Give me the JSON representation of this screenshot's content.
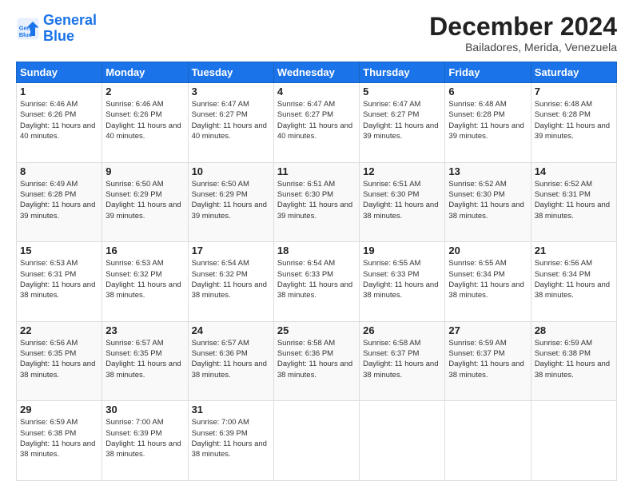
{
  "logo": {
    "line1": "General",
    "line2": "Blue"
  },
  "title": "December 2024",
  "location": "Bailadores, Merida, Venezuela",
  "days_header": [
    "Sunday",
    "Monday",
    "Tuesday",
    "Wednesday",
    "Thursday",
    "Friday",
    "Saturday"
  ],
  "weeks": [
    [
      {
        "day": "1",
        "sunrise": "6:46 AM",
        "sunset": "6:26 PM",
        "daylight": "11 hours and 40 minutes."
      },
      {
        "day": "2",
        "sunrise": "6:46 AM",
        "sunset": "6:26 PM",
        "daylight": "11 hours and 40 minutes."
      },
      {
        "day": "3",
        "sunrise": "6:47 AM",
        "sunset": "6:27 PM",
        "daylight": "11 hours and 40 minutes."
      },
      {
        "day": "4",
        "sunrise": "6:47 AM",
        "sunset": "6:27 PM",
        "daylight": "11 hours and 40 minutes."
      },
      {
        "day": "5",
        "sunrise": "6:47 AM",
        "sunset": "6:27 PM",
        "daylight": "11 hours and 39 minutes."
      },
      {
        "day": "6",
        "sunrise": "6:48 AM",
        "sunset": "6:28 PM",
        "daylight": "11 hours and 39 minutes."
      },
      {
        "day": "7",
        "sunrise": "6:48 AM",
        "sunset": "6:28 PM",
        "daylight": "11 hours and 39 minutes."
      }
    ],
    [
      {
        "day": "8",
        "sunrise": "6:49 AM",
        "sunset": "6:28 PM",
        "daylight": "11 hours and 39 minutes."
      },
      {
        "day": "9",
        "sunrise": "6:50 AM",
        "sunset": "6:29 PM",
        "daylight": "11 hours and 39 minutes."
      },
      {
        "day": "10",
        "sunrise": "6:50 AM",
        "sunset": "6:29 PM",
        "daylight": "11 hours and 39 minutes."
      },
      {
        "day": "11",
        "sunrise": "6:51 AM",
        "sunset": "6:30 PM",
        "daylight": "11 hours and 39 minutes."
      },
      {
        "day": "12",
        "sunrise": "6:51 AM",
        "sunset": "6:30 PM",
        "daylight": "11 hours and 38 minutes."
      },
      {
        "day": "13",
        "sunrise": "6:52 AM",
        "sunset": "6:30 PM",
        "daylight": "11 hours and 38 minutes."
      },
      {
        "day": "14",
        "sunrise": "6:52 AM",
        "sunset": "6:31 PM",
        "daylight": "11 hours and 38 minutes."
      }
    ],
    [
      {
        "day": "15",
        "sunrise": "6:53 AM",
        "sunset": "6:31 PM",
        "daylight": "11 hours and 38 minutes."
      },
      {
        "day": "16",
        "sunrise": "6:53 AM",
        "sunset": "6:32 PM",
        "daylight": "11 hours and 38 minutes."
      },
      {
        "day": "17",
        "sunrise": "6:54 AM",
        "sunset": "6:32 PM",
        "daylight": "11 hours and 38 minutes."
      },
      {
        "day": "18",
        "sunrise": "6:54 AM",
        "sunset": "6:33 PM",
        "daylight": "11 hours and 38 minutes."
      },
      {
        "day": "19",
        "sunrise": "6:55 AM",
        "sunset": "6:33 PM",
        "daylight": "11 hours and 38 minutes."
      },
      {
        "day": "20",
        "sunrise": "6:55 AM",
        "sunset": "6:34 PM",
        "daylight": "11 hours and 38 minutes."
      },
      {
        "day": "21",
        "sunrise": "6:56 AM",
        "sunset": "6:34 PM",
        "daylight": "11 hours and 38 minutes."
      }
    ],
    [
      {
        "day": "22",
        "sunrise": "6:56 AM",
        "sunset": "6:35 PM",
        "daylight": "11 hours and 38 minutes."
      },
      {
        "day": "23",
        "sunrise": "6:57 AM",
        "sunset": "6:35 PM",
        "daylight": "11 hours and 38 minutes."
      },
      {
        "day": "24",
        "sunrise": "6:57 AM",
        "sunset": "6:36 PM",
        "daylight": "11 hours and 38 minutes."
      },
      {
        "day": "25",
        "sunrise": "6:58 AM",
        "sunset": "6:36 PM",
        "daylight": "11 hours and 38 minutes."
      },
      {
        "day": "26",
        "sunrise": "6:58 AM",
        "sunset": "6:37 PM",
        "daylight": "11 hours and 38 minutes."
      },
      {
        "day": "27",
        "sunrise": "6:59 AM",
        "sunset": "6:37 PM",
        "daylight": "11 hours and 38 minutes."
      },
      {
        "day": "28",
        "sunrise": "6:59 AM",
        "sunset": "6:38 PM",
        "daylight": "11 hours and 38 minutes."
      }
    ],
    [
      {
        "day": "29",
        "sunrise": "6:59 AM",
        "sunset": "6:38 PM",
        "daylight": "11 hours and 38 minutes."
      },
      {
        "day": "30",
        "sunrise": "7:00 AM",
        "sunset": "6:39 PM",
        "daylight": "11 hours and 38 minutes."
      },
      {
        "day": "31",
        "sunrise": "7:00 AM",
        "sunset": "6:39 PM",
        "daylight": "11 hours and 38 minutes."
      },
      null,
      null,
      null,
      null
    ]
  ]
}
